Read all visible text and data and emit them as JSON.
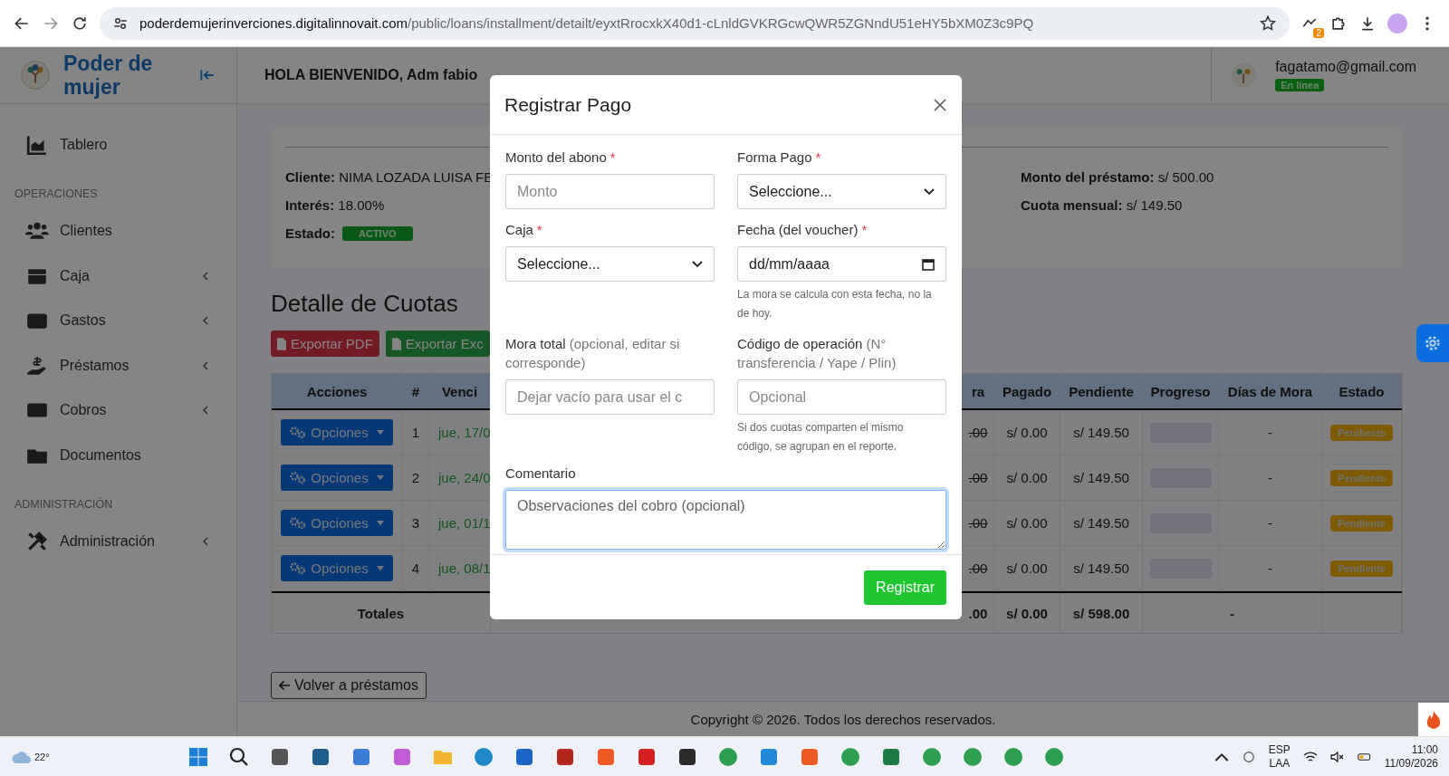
{
  "browser": {
    "url_host": "poderdemujerinverciones.digitalinnovait.com",
    "url_path": "/public/loans/installment/detailt/eyxtRrocxkX40d1-cLnldGVKRGcwQWR5ZGNndU51eHY5bXM0Z3c9PQ",
    "extension_badge": "2"
  },
  "sidebar": {
    "brand": "Poder de mujer",
    "items": [
      {
        "kind": "item",
        "label": "Tablero",
        "submenu": false
      },
      {
        "kind": "section",
        "label": "OPERACIONES"
      },
      {
        "kind": "item",
        "label": "Clientes",
        "submenu": false
      },
      {
        "kind": "item",
        "label": "Caja",
        "submenu": true
      },
      {
        "kind": "item",
        "label": "Gastos",
        "submenu": true
      },
      {
        "kind": "item",
        "label": "Préstamos",
        "submenu": true
      },
      {
        "kind": "item",
        "label": "Cobros",
        "submenu": true
      },
      {
        "kind": "item",
        "label": "Documentos",
        "submenu": false
      },
      {
        "kind": "section",
        "label": "ADMINISTRACIÓN"
      },
      {
        "kind": "item",
        "label": "Administración",
        "submenu": true
      }
    ]
  },
  "header": {
    "greeting": "HOLA BIENVENIDO, Adm fabio",
    "email": "fagatamo@gmail.com",
    "status": "En línea"
  },
  "loan": {
    "left": [
      "**Cliente:** NIMA LOZADA LUISA FE",
      "**Interés:** 18.00%"
    ],
    "estado_label": "Estado:",
    "estado": "ACTIVO",
    "right": [
      "**Monto del préstamo:** s/ 500.00",
      "**Cuota mensual:** s/ 149.50"
    ]
  },
  "section_title": "Detalle de Cuotas",
  "export_buttons": [
    {
      "kind": "pdf",
      "label": "Exportar PDF"
    },
    {
      "kind": "excel",
      "label": "Exportar Exc"
    }
  ],
  "table": {
    "left_columns": [
      "Acciones",
      "#",
      "Venci"
    ],
    "right_columns": [
      "ra",
      "Pagado",
      "Pendiente",
      "Progreso",
      "Días de Mora",
      "Estado"
    ],
    "rows": [
      {
        "action": "Opciones",
        "number": "1",
        "due": "jue, 17/0",
        "mora": ".00",
        "mora_struck": true,
        "paid": "s/ 0.00",
        "pending": "s/ 149.50",
        "level": 0,
        "days": "-",
        "status": "Pendiente"
      },
      {
        "action": "Opciones",
        "number": "2",
        "due": "jue, 24/0",
        "mora": ".00",
        "mora_struck": true,
        "paid": "s/ 0.00",
        "pending": "s/ 149.50",
        "level": 0,
        "days": "-",
        "status": "Pendiente"
      },
      {
        "action": "Opciones",
        "number": "3",
        "due": "jue, 01/1",
        "mora": ".00",
        "mora_struck": true,
        "paid": "s/ 0.00",
        "pending": "s/ 149.50",
        "level": 0,
        "days": "-",
        "status": "Pendiente"
      },
      {
        "action": "Opciones",
        "number": "4",
        "due": "jue, 08/1",
        "mora": ".00",
        "mora_struck": true,
        "paid": "s/ 0.00",
        "pending": "s/ 149.50",
        "level": 0,
        "days": "-",
        "status": "Pendiente"
      }
    ],
    "totals": {
      "label": "Totales",
      "mora": ".00",
      "paid": "s/ 0.00",
      "pending": "s/ 598.00",
      "days": "-"
    }
  },
  "back_button": "Volver a préstamos",
  "footer": "Copyright © 2026. Todos los derechos reservados.",
  "modal": {
    "title": "Registrar Pago",
    "fields": [
      {
        "kind": "input",
        "label": "Monto del abono",
        "required_mark": "*",
        "placeholder": "Monto"
      },
      {
        "kind": "select",
        "label": "Forma Pago",
        "required_mark": "*",
        "value": "Seleccione..."
      },
      {
        "kind": "select",
        "label": "Caja",
        "required_mark": "*",
        "value": "Seleccione..."
      },
      {
        "kind": "date",
        "label": "Fecha (del voucher)",
        "required_mark": "*",
        "value": "dd/mm/aaaa",
        "help": "La mora se calcula con esta fecha, no la de hoy."
      },
      {
        "kind": "input",
        "label": "Mora total",
        "note": "(opcional, editar si corresponde)",
        "placeholder": "Dejar vacío para usar el c"
      },
      {
        "kind": "input",
        "label": "Código de operación",
        "note": "(N° transferencia / Yape / Plin)",
        "placeholder": "Opcional",
        "help": "Si dos cuotas comparten el mismo código, se agrupan en el reporte."
      }
    ],
    "comment": {
      "label": "Comentario",
      "placeholder": "Observaciones del cobro (opcional)",
      "focused": true
    },
    "submit": "Registrar"
  },
  "taskbar": {
    "weather": "22°",
    "lang_top": "ESP",
    "lang_bottom": "LAA",
    "time": "11:00",
    "date": "11/09/2026"
  }
}
